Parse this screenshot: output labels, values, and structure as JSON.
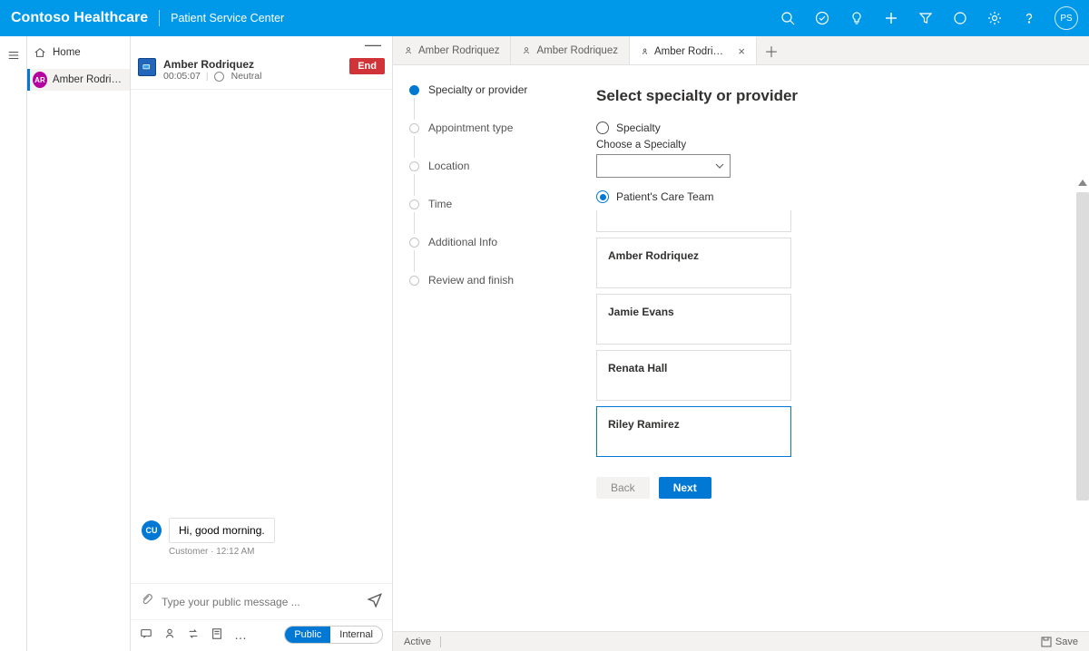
{
  "header": {
    "brand": "Contoso Healthcare",
    "subtitle": "Patient Service Center",
    "avatar_initials": "PS"
  },
  "sessions": {
    "home_label": "Home",
    "active_initials": "AR",
    "active_name": "Amber Rodriquez"
  },
  "chat": {
    "name": "Amber Rodriquez",
    "timer": "00:05:07",
    "sentiment": "Neutral",
    "end_label": "End",
    "cu_initials": "CU",
    "message": "Hi, good morning.",
    "message_meta": "Customer · 12:12 AM",
    "input_placeholder": "Type your public message ...",
    "pill_public": "Public",
    "pill_internal": "Internal"
  },
  "tabs": {
    "t1": "Amber Rodriquez",
    "t2": "Amber Rodriquez",
    "t3": "Amber Rodriquez"
  },
  "stepper": {
    "s1": "Specialty or provider",
    "s2": "Appointment type",
    "s3": "Location",
    "s4": "Time",
    "s5": "Additional Info",
    "s6": "Review and finish"
  },
  "form": {
    "title": "Select specialty or provider",
    "radio_specialty": "Specialty",
    "choose_label": "Choose a Specialty",
    "radio_careteam": "Patient's Care Team",
    "providers": {
      "p1": "Amber Rodriquez",
      "p2": "Jamie Evans",
      "p3": "Renata Hall",
      "p4": "Riley Ramirez"
    },
    "back": "Back",
    "next": "Next"
  },
  "status": {
    "active": "Active",
    "save": "Save"
  }
}
